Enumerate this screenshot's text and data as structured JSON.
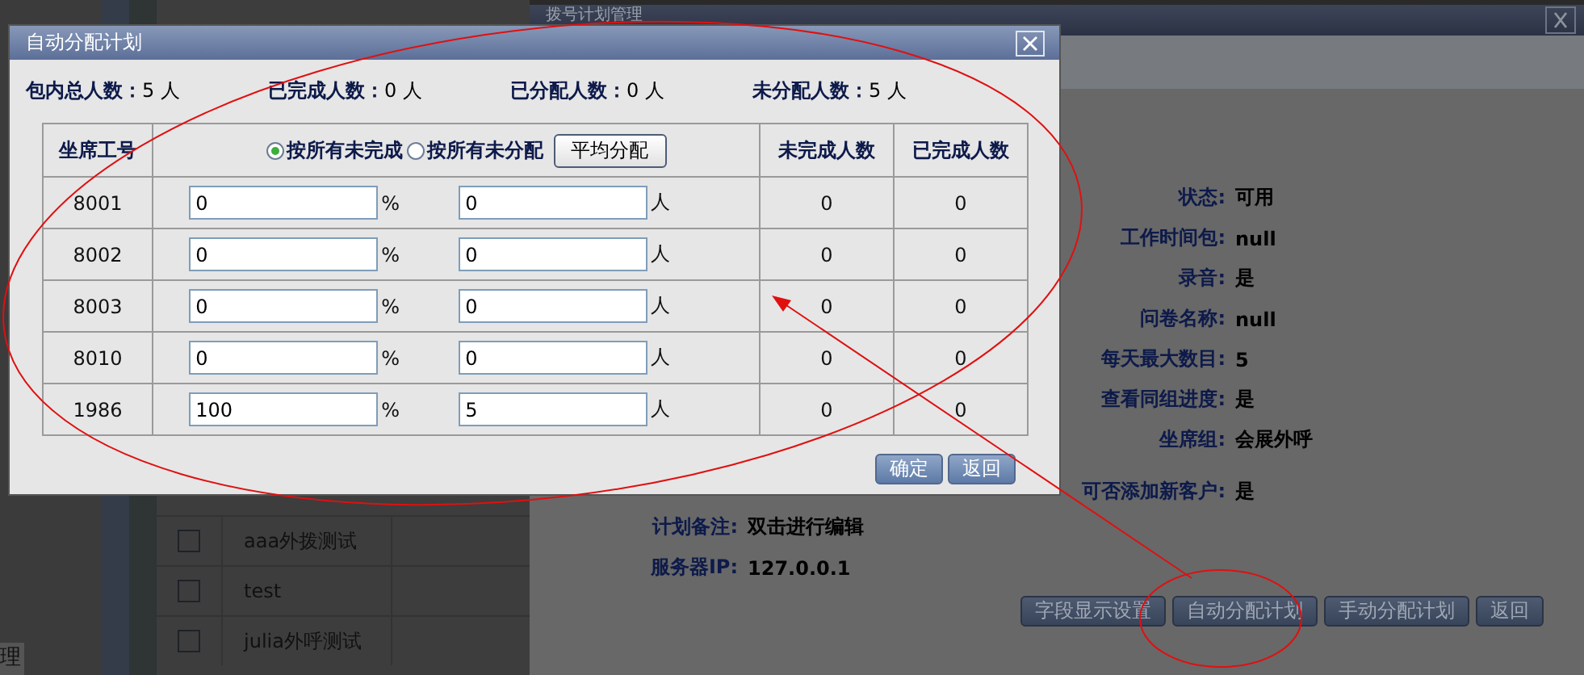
{
  "sidebar": {
    "fragment": "理"
  },
  "background_list": {
    "rows": [
      {
        "name": "aaa外拨测试",
        "checked": false
      },
      {
        "name": "test",
        "checked": false
      },
      {
        "name": "julia外呼测试",
        "checked": false
      }
    ]
  },
  "plan_window": {
    "title": "拨号计划管理",
    "details": [
      {
        "label": "状态:",
        "value": "可用"
      },
      {
        "label": "工作时间包:",
        "value": "null"
      },
      {
        "label": "录音:",
        "value": "是"
      },
      {
        "label": "问卷名称:",
        "value": "null"
      },
      {
        "label": "每天最大数目:",
        "value": "5"
      },
      {
        "label": "查看同组进度:",
        "value": "是"
      },
      {
        "label": "坐席组:",
        "value": "会展外呼"
      },
      {
        "label": "可否添加新客户:",
        "value": "是"
      }
    ],
    "notes": [
      {
        "label": "计划备注:",
        "value": "双击进行编辑"
      },
      {
        "label": "服务器IP:",
        "value": "127.0.0.1"
      }
    ],
    "buttons": [
      "字段显示设置",
      "自动分配计划",
      "手动分配计划",
      "返回"
    ]
  },
  "dialog": {
    "title": "自动分配计划",
    "stats": [
      {
        "label": "包内总人数：",
        "value": "5 人"
      },
      {
        "label": "已完成人数：",
        "value": "0 人"
      },
      {
        "label": "已分配人数：",
        "value": "0 人"
      },
      {
        "label": "未分配人数：",
        "value": "5 人"
      }
    ],
    "table": {
      "agent_header": "坐席工号",
      "unfinished_header": "未完成人数",
      "finished_header": "已完成人数",
      "modes": [
        {
          "label": "按所有未完成",
          "selected": true
        },
        {
          "label": "按所有未分配",
          "selected": false
        }
      ],
      "distribute_button": "平均分配",
      "rows": [
        {
          "agent": "8001",
          "percent": "0",
          "percent_unit": "%",
          "count": "0",
          "count_unit": "人",
          "unfinished": "0",
          "finished": "0"
        },
        {
          "agent": "8002",
          "percent": "0",
          "percent_unit": "%",
          "count": "0",
          "count_unit": "人",
          "unfinished": "0",
          "finished": "0"
        },
        {
          "agent": "8003",
          "percent": "0",
          "percent_unit": "%",
          "count": "0",
          "count_unit": "人",
          "unfinished": "0",
          "finished": "0"
        },
        {
          "agent": "8010",
          "percent": "0",
          "percent_unit": "%",
          "count": "0",
          "count_unit": "人",
          "unfinished": "0",
          "finished": "0"
        },
        {
          "agent": "1986",
          "percent": "100",
          "percent_unit": "%",
          "count": "5",
          "count_unit": "人",
          "unfinished": "0",
          "finished": "0"
        }
      ]
    },
    "buttons": [
      "确定",
      "返回"
    ]
  }
}
